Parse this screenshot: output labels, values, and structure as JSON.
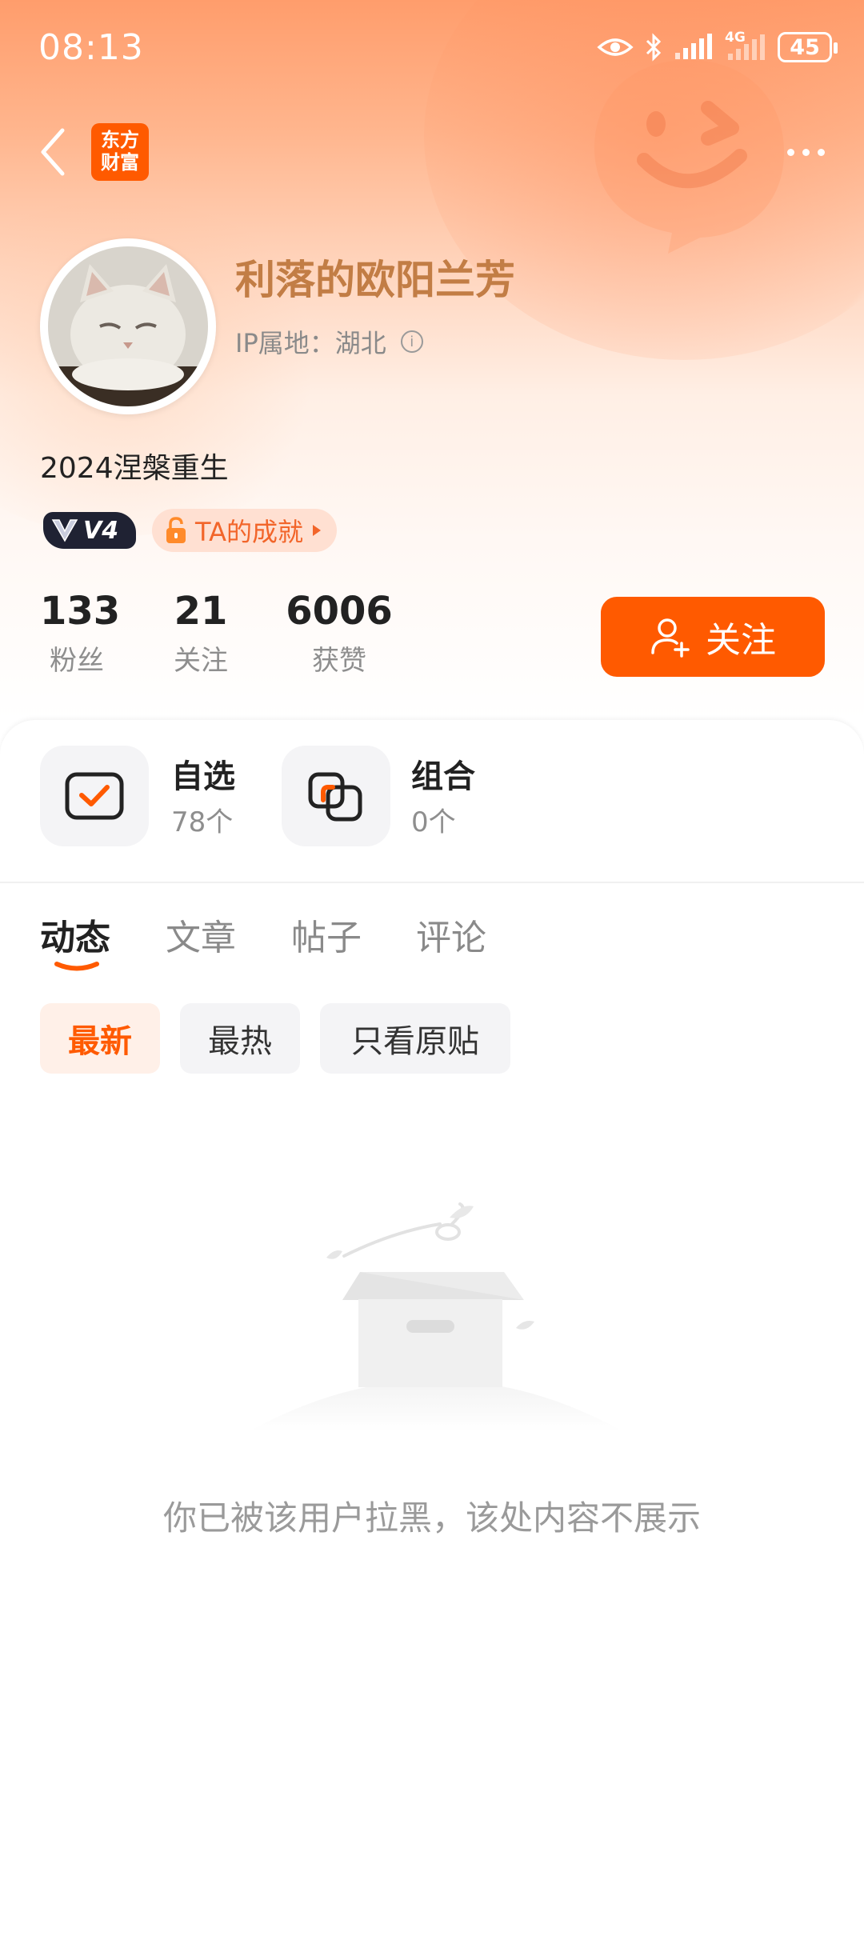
{
  "status_bar": {
    "time": "08:13",
    "network": "4G",
    "battery": "45"
  },
  "nav": {
    "logo_line1": "东方",
    "logo_line2": "财富"
  },
  "profile": {
    "name": "利落的欧阳兰芳",
    "ip_location": "IP属地：湖北",
    "bio": "2024涅槃重生",
    "level_badge": "V4",
    "achievement": "TA的成就"
  },
  "stats": [
    {
      "value": "133",
      "label": "粉丝"
    },
    {
      "value": "21",
      "label": "关注"
    },
    {
      "value": "6006",
      "label": "获赞"
    }
  ],
  "follow_button": "关注",
  "quick_entries": [
    {
      "label": "自选",
      "count": "78个"
    },
    {
      "label": "组合",
      "count": "0个"
    }
  ],
  "tabs": [
    "动态",
    "文章",
    "帖子",
    "评论"
  ],
  "filters": [
    "最新",
    "最热",
    "只看原贴"
  ],
  "empty_message": "你已被该用户拉黑，该处内容不展示",
  "colors": {
    "accent": "#ff5a00",
    "name": "#c27d45",
    "muted": "#8e8e8e"
  }
}
